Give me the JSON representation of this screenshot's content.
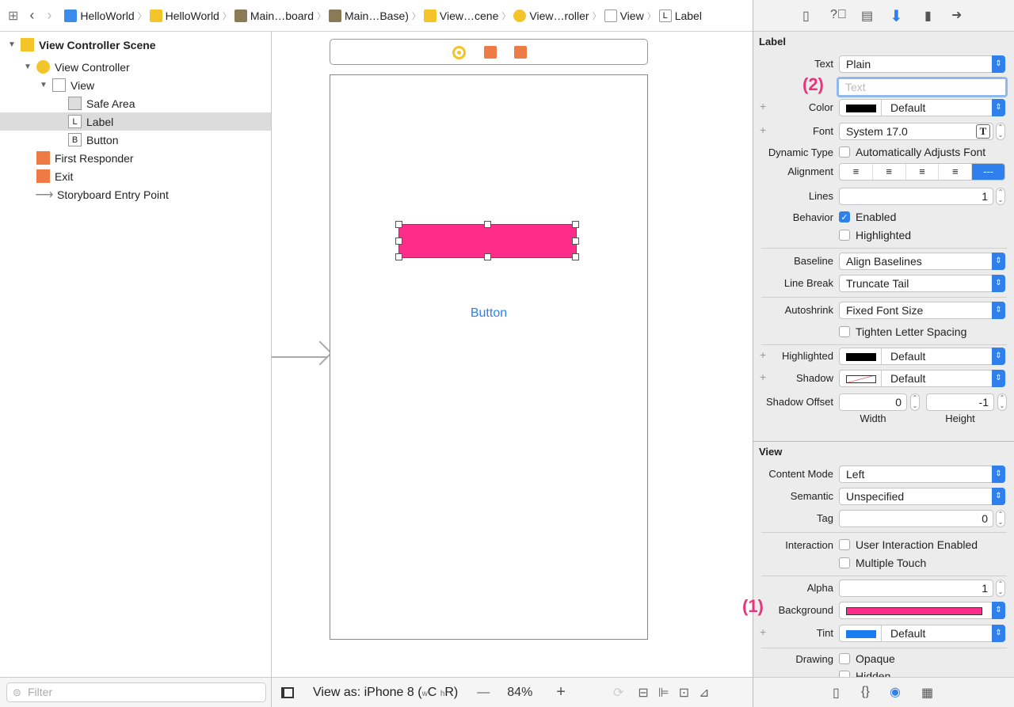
{
  "breadcrumb": [
    "HelloWorld",
    "HelloWorld",
    "Main…board",
    "Main…Base)",
    "View…cene",
    "View…roller",
    "View",
    "Label"
  ],
  "outline": [
    {
      "label": "View Controller Scene",
      "bold": true,
      "indent": 0,
      "tri": "▼",
      "icon": "scene-icon",
      "color": "#f3c52b"
    },
    {
      "label": "View Controller",
      "indent": 1,
      "tri": "▼",
      "icon": "view-controller-icon",
      "color": "#f3c52b"
    },
    {
      "label": "View",
      "indent": 2,
      "tri": "▼",
      "icon": "view-icon",
      "color": "#fff"
    },
    {
      "label": "Safe Area",
      "indent": 3,
      "tri": "",
      "icon": "safe-area-icon",
      "color": "#ddd"
    },
    {
      "label": "Label",
      "indent": 3,
      "tri": "",
      "icon": "label-icon",
      "glyph": "L",
      "color": "#fff",
      "selected": true
    },
    {
      "label": "Button",
      "indent": 3,
      "tri": "",
      "icon": "button-icon",
      "glyph": "B",
      "color": "#fff"
    },
    {
      "label": "First Responder",
      "indent": 1,
      "tri": "",
      "icon": "first-responder-icon",
      "color": "#ee7a45"
    },
    {
      "label": "Exit",
      "indent": 1,
      "tri": "",
      "icon": "exit-icon",
      "color": "#ee7a45"
    },
    {
      "label": "Storyboard Entry Point",
      "indent": 1,
      "tri": "",
      "icon": "entry-arrow-icon",
      "color": "none"
    }
  ],
  "filter_placeholder": "Filter",
  "canvas": {
    "button_label": "Button",
    "label_bg": "#ff2d8a",
    "view_as": "View as: iPhone 8 (",
    "w": "w",
    "c": "C",
    "h": "h",
    "r": "R)",
    "zoom": "84%",
    "minus": "—",
    "plus": "+"
  },
  "inspector": {
    "label_section": "Label",
    "view_section": "View",
    "rows": [
      {
        "label": "Text",
        "type": "popup",
        "value": "Plain"
      },
      {
        "label": "",
        "type": "textfield",
        "placeholder": "Text"
      },
      {
        "label": "Color",
        "type": "color",
        "swatch": "#000000",
        "value": "Default",
        "plus": true
      },
      {
        "label": "Font",
        "type": "font",
        "value": "System 17.0",
        "plus": true
      },
      {
        "label": "Dynamic Type",
        "type": "check",
        "value": "Automatically Adjusts Font",
        "checked": false
      },
      {
        "label": "Alignment",
        "type": "align"
      },
      {
        "label": "Lines",
        "type": "number",
        "value": "1"
      },
      {
        "label": "Behavior",
        "type": "check",
        "value": "Enabled",
        "checked": true
      },
      {
        "label": "",
        "type": "check",
        "value": "Highlighted",
        "checked": false
      },
      {
        "type": "hr"
      },
      {
        "label": "Baseline",
        "type": "popup",
        "value": "Align Baselines"
      },
      {
        "label": "Line Break",
        "type": "popup",
        "value": "Truncate Tail"
      },
      {
        "type": "hr"
      },
      {
        "label": "Autoshrink",
        "type": "popup",
        "value": "Fixed Font Size"
      },
      {
        "label": "",
        "type": "check",
        "value": "Tighten Letter Spacing",
        "checked": false
      },
      {
        "type": "hr"
      },
      {
        "label": "Highlighted",
        "type": "color",
        "swatch": "#000000",
        "value": "Default",
        "plus": true
      },
      {
        "label": "Shadow",
        "type": "color",
        "swatch": "shadow",
        "value": "Default",
        "plus": true
      },
      {
        "label": "Shadow Offset",
        "type": "pair",
        "a": "0",
        "b": "-1",
        "alabel": "Width",
        "blabel": "Height"
      },
      {
        "type": "hr"
      },
      {
        "type": "section"
      },
      {
        "label": "Content Mode",
        "type": "popup",
        "value": "Left"
      },
      {
        "label": "Semantic",
        "type": "popup",
        "value": "Unspecified"
      },
      {
        "label": "Tag",
        "type": "number",
        "value": "0"
      },
      {
        "type": "hr"
      },
      {
        "label": "Interaction",
        "type": "check",
        "value": "User Interaction Enabled",
        "checked": false
      },
      {
        "label": "",
        "type": "check",
        "value": "Multiple Touch",
        "checked": false
      },
      {
        "type": "hr"
      },
      {
        "label": "Alpha",
        "type": "number",
        "value": "1"
      },
      {
        "label": "Background",
        "type": "bgcolor",
        "swatch": "#ff2d8a"
      },
      {
        "label": "Tint",
        "type": "color",
        "swatch": "#1a7cf0",
        "value": "Default",
        "plus": true
      },
      {
        "type": "hr"
      },
      {
        "label": "Drawing",
        "type": "check",
        "value": "Opaque",
        "checked": false
      },
      {
        "label": "",
        "type": "check",
        "value": "Hidden",
        "checked": false
      }
    ]
  },
  "annotations": {
    "one": "(1)",
    "two": "(2)"
  },
  "accent": "#2f80ed"
}
